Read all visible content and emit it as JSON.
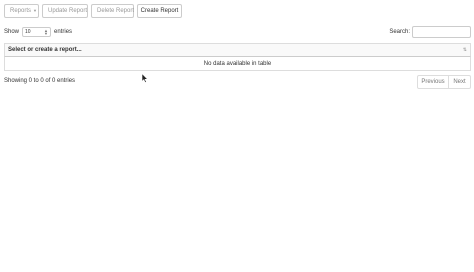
{
  "toolbar": {
    "reports_label": "Reports",
    "update_label": "Update Report",
    "delete_label": "Delete Report",
    "create_label": "Create Report"
  },
  "length": {
    "show_label": "Show",
    "selected": "10",
    "entries_label": "entries"
  },
  "search": {
    "label": "Search:",
    "value": ""
  },
  "table": {
    "header": "Select or create a report...",
    "empty_message": "No data available in table"
  },
  "footer": {
    "info": "Showing 0 to 0 of 0 entries",
    "prev_label": "Previous",
    "next_label": "Next"
  },
  "icons": {
    "caret": "caret-down-icon",
    "sort": "sort-alpha-icon",
    "cursor": "mouse-pointer-icon"
  },
  "colors": {
    "border": "#cccccc",
    "disabled_text": "#999999",
    "text": "#333333",
    "header_bg": "#f9f9f9"
  }
}
